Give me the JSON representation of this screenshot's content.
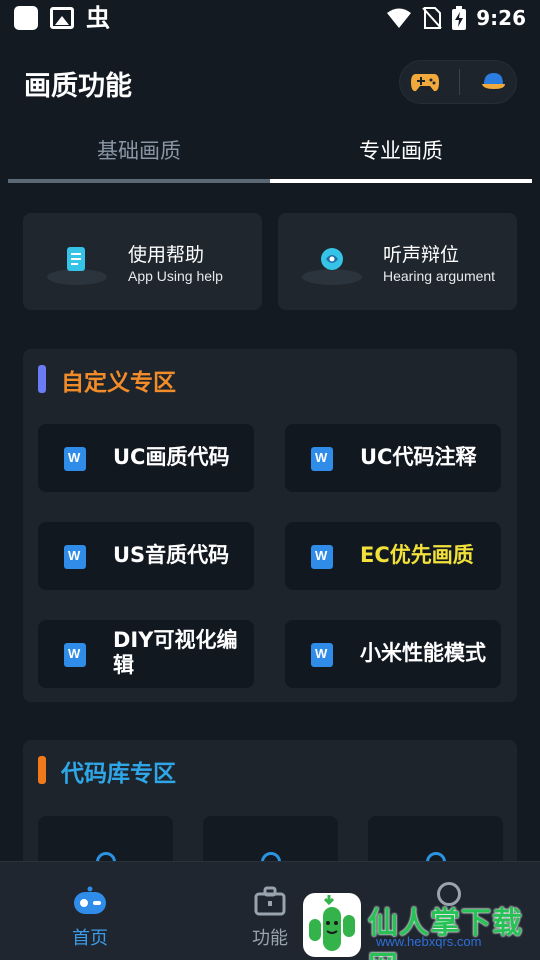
{
  "status_bar": {
    "time": "9:26",
    "left_icons": [
      "notification-square-icon",
      "image-icon",
      "bug-icon"
    ],
    "bug_glyph": "虫",
    "right_icons": [
      "wifi-icon",
      "no-sim-icon",
      "battery-charging-icon"
    ]
  },
  "header": {
    "title": "画质功能",
    "capsule_icons": [
      "game-controller-icon",
      "cap-icon"
    ]
  },
  "tabs": [
    {
      "label": "基础画质",
      "active": false
    },
    {
      "label": "专业画质",
      "active": true
    }
  ],
  "help_cards": [
    {
      "title": "使用帮助",
      "subtitle": "App Using help",
      "icon": "document-icon"
    },
    {
      "title": "听声辩位",
      "subtitle": "Hearing argument",
      "icon": "hearing-icon"
    }
  ],
  "custom_section": {
    "title": "自定义专区",
    "title_color": "#f28c28",
    "bar_color": "#6a7cf5",
    "items": [
      {
        "label": "UC画质代码",
        "color": "#ffffff"
      },
      {
        "label": "UC代码注释",
        "color": "#ffffff"
      },
      {
        "label": "US音质代码",
        "color": "#ffffff"
      },
      {
        "label": "EC优先画质",
        "color": "#f2e13a"
      },
      {
        "label": "DIY可视化编辑",
        "color": "#ffffff"
      },
      {
        "label": "小米性能模式",
        "color": "#ffffff"
      }
    ]
  },
  "library_section": {
    "title": "代码库专区",
    "title_color": "#2fa6e8",
    "bar_color": "#f07a1a"
  },
  "bottom_nav": [
    {
      "label": "首页",
      "icon": "robot-home-icon",
      "active": true
    },
    {
      "label": "功能",
      "icon": "briefcase-icon",
      "active": false
    }
  ],
  "watermark": {
    "text": "仙人掌下载网",
    "url": "www.hebxqrs.com"
  },
  "colors": {
    "background": "#141a21",
    "card": "#1f262e",
    "accent_blue": "#3c9be8"
  }
}
